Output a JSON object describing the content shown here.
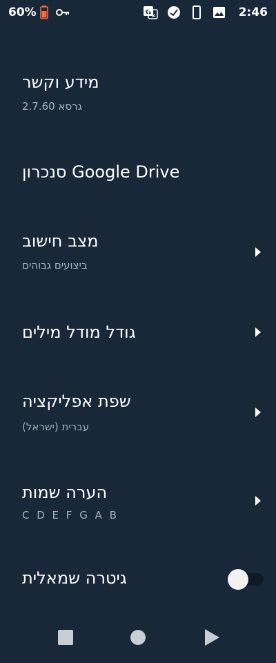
{
  "status_bar": {
    "battery_percent": "60%",
    "time": "2:46",
    "icons": [
      "battery-icon",
      "vpn-key-icon",
      "translate-icon",
      "security-icon",
      "phone-icon",
      "image-icon"
    ]
  },
  "settings": {
    "about": {
      "title": "מידע וקשר",
      "subtitle": "גרסא 2.7.60"
    },
    "drive_sync": {
      "title": "סנכרון Google Drive"
    },
    "compute_mode": {
      "title": "מצב חישוב",
      "subtitle": "ביצועים גבוהים"
    },
    "word_model_size": {
      "title": "גודל מודל מילים"
    },
    "app_language": {
      "title": "שפת אפליקציה",
      "subtitle": "עברית (ישראל)"
    },
    "note_names": {
      "title": "הערה שמות",
      "subtitle": "C D E F G A B"
    },
    "left_guitar": {
      "title": "גיטרה שמאלית",
      "enabled": false
    }
  },
  "colors": {
    "background": "#182838",
    "text_primary": "#ffffff",
    "text_secondary": "#aab2bc",
    "battery_accent": "#f26b3a"
  },
  "nav_bar": {
    "icons": [
      "recents-icon",
      "home-icon",
      "back-icon"
    ]
  }
}
